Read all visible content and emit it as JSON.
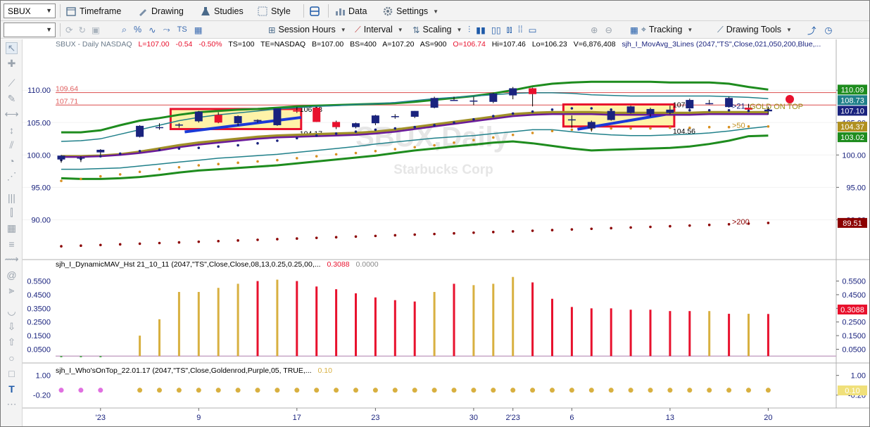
{
  "toolbar1": {
    "symbol": "SBUX",
    "timeframe": "Timeframe",
    "drawing": "Drawing",
    "studies": "Studies",
    "style": "Style",
    "data": "Data",
    "settings": "Settings"
  },
  "toolbar2": {
    "interval_box": "",
    "session_hours": "Session Hours",
    "interval": "Interval",
    "scaling": "Scaling",
    "tracking": "Tracking",
    "drawing_tools": "Drawing Tools"
  },
  "colors": {
    "up": "#1a237e",
    "down": "#e8112d",
    "ma21": "#6a1b9a",
    "ma50": "#8b8b22",
    "ma200": "#8b0000",
    "env_green": "#1e8c1e",
    "env_teal": "#20808a",
    "gold": "#d8b040",
    "redline": "#e06060"
  },
  "chart_data": [
    {
      "type": "candlestick",
      "title": "SBUX - Daily  NASDAQ",
      "header": {
        "last": "L=107.00",
        "chg": "-0.54",
        "pct": "-0.50%",
        "ts": "TS=100",
        "te": "TE=NASDAQ",
        "bid": "B=107.00",
        "bs": "BS=400",
        "ask": "A=107.20",
        "as": "AS=900",
        "open": "O=106.74",
        "hi": "Hi=107.46",
        "lo": "Lo=106.23",
        "vol": "V=6,876,408",
        "study": "sjh_I_MovAvg_3Lines (2047,\"TS\",Close,021,050,200,Blue,..."
      },
      "watermark": "SBUX,Daily",
      "watermark_sub": "Starbucks Corp",
      "ylim": [
        84.5,
        116.0
      ],
      "yticks": [
        "110.00",
        "105.00",
        "100.00",
        "95.00",
        "90.00"
      ],
      "ytick_values": [
        110,
        105,
        100,
        95,
        90
      ],
      "xticks": [
        {
          "label": "'23",
          "i": 2
        },
        {
          "label": "9",
          "i": 7
        },
        {
          "label": "17",
          "i": 12
        },
        {
          "label": "23",
          "i": 16
        },
        {
          "label": "30",
          "i": 21
        },
        {
          "label": "2'23",
          "i": 23
        },
        {
          "label": "6",
          "i": 26
        },
        {
          "label": "13",
          "i": 31
        },
        {
          "label": "20",
          "i": 36
        }
      ],
      "candles": [
        {
          "o": 99.3,
          "h": 100.0,
          "l": 98.8,
          "c": 99.9
        },
        {
          "o": 99.6,
          "h": 99.8,
          "l": 98.9,
          "c": 99.6
        },
        {
          "o": 100.4,
          "h": 100.9,
          "l": 100.0,
          "c": 100.8
        },
        {
          "o": 0,
          "h": 0,
          "l": 0,
          "c": 0
        },
        {
          "o": 102.8,
          "h": 104.6,
          "l": 102.7,
          "c": 104.5
        },
        {
          "o": 104.3,
          "h": 104.9,
          "l": 103.9,
          "c": 104.3
        },
        {
          "o": 104.7,
          "h": 104.9,
          "l": 104.2,
          "c": 104.7
        },
        {
          "o": 105.2,
          "h": 106.8,
          "l": 105.0,
          "c": 106.7
        },
        {
          "o": 106.2,
          "h": 106.6,
          "l": 104.9,
          "c": 105.0
        },
        {
          "o": 104.9,
          "h": 106.1,
          "l": 104.5,
          "c": 106.0
        },
        {
          "o": 105.2,
          "h": 105.5,
          "l": 105.0,
          "c": 105.4
        },
        {
          "o": 104.6,
          "h": 107.2,
          "l": 104.5,
          "c": 107.2
        },
        {
          "o": 106.9,
          "h": 107.4,
          "l": 106.5,
          "c": 106.7
        },
        {
          "o": 107.3,
          "h": 107.4,
          "l": 105.1,
          "c": 105.1
        },
        {
          "o": 105.1,
          "h": 105.3,
          "l": 104.0,
          "c": 104.3
        },
        {
          "o": 104.3,
          "h": 105.0,
          "l": 104.1,
          "c": 104.9
        },
        {
          "o": 104.9,
          "h": 106.2,
          "l": 104.6,
          "c": 106.1
        },
        {
          "o": 106.0,
          "h": 106.3,
          "l": 105.6,
          "c": 106.0
        },
        {
          "o": 105.9,
          "h": 106.8,
          "l": 105.7,
          "c": 106.8
        },
        {
          "o": 107.3,
          "h": 109.0,
          "l": 107.2,
          "c": 108.8
        },
        {
          "o": 108.5,
          "h": 109.0,
          "l": 108.4,
          "c": 108.5
        },
        {
          "o": 108.4,
          "h": 109.0,
          "l": 107.7,
          "c": 108.4
        },
        {
          "o": 108.2,
          "h": 109.6,
          "l": 108.0,
          "c": 109.5
        },
        {
          "o": 109.2,
          "h": 110.5,
          "l": 108.6,
          "c": 110.3
        },
        {
          "o": 110.3,
          "h": 110.4,
          "l": 107.5,
          "c": 109.4
        },
        {
          "o": 0,
          "h": 0,
          "l": 0,
          "c": 0
        },
        {
          "o": 105.5,
          "h": 106.1,
          "l": 104.2,
          "c": 105.5
        },
        {
          "o": 104.1,
          "h": 105.3,
          "l": 103.6,
          "c": 105.1
        },
        {
          "o": 105.4,
          "h": 106.9,
          "l": 105.3,
          "c": 106.8
        },
        {
          "o": 106.5,
          "h": 107.6,
          "l": 106.4,
          "c": 107.5
        },
        {
          "o": 106.3,
          "h": 107.3,
          "l": 105.9,
          "c": 107.1
        },
        {
          "o": 106.5,
          "h": 107.6,
          "l": 106.3,
          "c": 107.0
        },
        {
          "o": 107.2,
          "h": 108.7,
          "l": 107.1,
          "c": 108.5
        },
        {
          "o": 108.0,
          "h": 108.5,
          "l": 107.8,
          "c": 108.0
        },
        {
          "o": 107.4,
          "h": 109.0,
          "l": 107.3,
          "c": 108.8
        },
        {
          "o": 107.3,
          "h": 107.9,
          "l": 106.9,
          "c": 107.0
        },
        {
          "o": 106.74,
          "h": 107.46,
          "l": 106.23,
          "c": 107.0
        }
      ],
      "lines": {
        "env_green_upper": [
          103.5,
          103.5,
          103.8,
          104.6,
          105.3,
          105.7,
          106.2,
          106.6,
          106.8,
          107.0,
          107.1,
          107.3,
          107.5,
          107.6,
          107.7,
          107.8,
          107.9,
          108.0,
          108.2,
          108.5,
          108.8,
          109.1,
          109.5,
          110.0,
          110.6,
          111.0,
          111.2,
          111.3,
          111.3,
          111.3,
          111.3,
          111.2,
          111.2,
          111.2,
          111.0,
          110.5,
          110.1
        ],
        "env_teal_upper": [
          102.1,
          102.2,
          102.5,
          103.2,
          103.9,
          104.6,
          105.3,
          105.8,
          106.2,
          106.5,
          106.8,
          107.1,
          107.3,
          107.5,
          107.6,
          107.8,
          107.9,
          108.1,
          108.4,
          108.7,
          108.9,
          109.1,
          109.3,
          109.5,
          109.6,
          109.6,
          109.5,
          109.3,
          109.2,
          109.1,
          109.1,
          109.1,
          109.1,
          109.1,
          109.0,
          108.9,
          108.7
        ],
        "ma50_gold": [
          99.8,
          99.8,
          99.9,
          100.1,
          100.5,
          101.0,
          101.5,
          101.9,
          102.2,
          102.5,
          102.8,
          103.0,
          103.1,
          103.2,
          103.3,
          103.4,
          103.6,
          103.9,
          104.3,
          104.7,
          105.1,
          105.5,
          105.9,
          106.3,
          106.5,
          106.6,
          106.6,
          106.6,
          106.5,
          106.5,
          106.5,
          106.5,
          106.5,
          106.6,
          106.6,
          106.6,
          106.6
        ],
        "ma21_purple": [
          99.7,
          99.7,
          99.8,
          100.0,
          100.3,
          100.7,
          101.2,
          101.6,
          101.9,
          102.2,
          102.5,
          102.7,
          102.8,
          102.9,
          103.0,
          103.1,
          103.3,
          103.6,
          104.0,
          104.4,
          104.8,
          105.2,
          105.6,
          106.0,
          106.2,
          106.3,
          106.3,
          106.3,
          106.2,
          106.2,
          106.2,
          106.2,
          106.2,
          106.3,
          106.3,
          106.3,
          106.3
        ],
        "env_teal_lower": [
          97.8,
          97.8,
          97.9,
          98.0,
          98.3,
          98.6,
          98.9,
          99.2,
          99.5,
          99.7,
          99.9,
          100.1,
          100.4,
          100.7,
          101.0,
          101.3,
          101.7,
          102.0,
          102.3,
          102.6,
          102.8,
          103.0,
          103.3,
          103.6,
          103.9,
          103.9,
          103.6,
          103.3,
          103.1,
          103.0,
          103.0,
          103.1,
          103.2,
          103.4,
          103.7,
          104.1,
          104.4
        ],
        "env_green_lower": [
          96.4,
          96.3,
          96.3,
          96.4,
          96.6,
          96.9,
          97.3,
          97.6,
          97.8,
          98.0,
          98.2,
          98.4,
          98.7,
          99.0,
          99.3,
          99.6,
          99.9,
          100.3,
          100.7,
          101.0,
          101.3,
          101.6,
          101.9,
          102.1,
          101.8,
          101.4,
          101.0,
          100.7,
          100.8,
          100.9,
          101.0,
          101.1,
          101.3,
          101.7,
          102.2,
          102.9,
          103.0
        ]
      },
      "dots": {
        "blue": [
          99.2,
          99.4,
          99.8,
          100.2,
          100.6,
          100.8,
          101.0,
          101.1,
          101.3,
          101.5,
          101.8,
          102.2,
          102.6,
          103.0,
          103.3,
          103.6,
          103.9,
          104.1,
          104.3,
          104.6,
          105.0,
          105.5,
          106.0,
          106.4,
          106.7,
          107.0,
          107.2,
          107.2,
          107.0,
          106.9,
          106.8,
          106.8,
          106.9,
          106.9,
          106.9,
          106.8,
          107.0
        ],
        "gold": [
          96.0,
          96.3,
          96.7,
          97.0,
          97.4,
          97.8,
          98.1,
          98.4,
          98.6,
          98.8,
          99.0,
          99.2,
          99.5,
          99.8,
          100.1,
          100.3,
          100.6,
          100.9,
          101.2,
          101.5,
          101.9,
          102.3,
          102.7,
          103.1,
          103.4,
          103.7,
          103.9,
          104.0,
          104.1,
          104.1,
          104.1,
          104.2,
          104.2,
          104.3,
          104.3,
          104.4,
          104.4
        ],
        "dkred": [
          85.9,
          86.0,
          86.1,
          86.2,
          86.3,
          86.4,
          86.5,
          86.6,
          86.7,
          86.8,
          86.9,
          87.0,
          87.1,
          87.2,
          87.3,
          87.4,
          87.5,
          87.6,
          87.7,
          87.8,
          87.9,
          88.0,
          88.1,
          88.2,
          88.3,
          88.4,
          88.5,
          88.6,
          88.7,
          88.8,
          88.9,
          89.0,
          89.1,
          89.2,
          89.3,
          89.4,
          89.51
        ]
      },
      "hlines": [
        {
          "value": 109.64,
          "label": "109.64",
          "color": "#e06060"
        },
        {
          "value": 107.71,
          "label": "107.71",
          "color": "#e06060"
        }
      ],
      "boxes": [
        {
          "i0": 6,
          "i1": 12,
          "top": 107.1,
          "bottom": 104.0,
          "label_top": "106.68",
          "label_bottom": "104.17"
        },
        {
          "i0": 26,
          "i1": 31,
          "top": 107.8,
          "bottom": 104.4,
          "label_top": "107.",
          "label_bottom": "104.56"
        }
      ],
      "right_labels": [
        {
          "text": ">21",
          "value": 107.6,
          "color": "#1a237e"
        },
        {
          "text": ">50",
          "value": 104.6,
          "color": "#c09020"
        },
        {
          "text": ">200",
          "value": 89.7,
          "color": "#8b0000"
        }
      ],
      "gold_on_top": "GOLD ON TOP",
      "value_badges": [
        {
          "text": "110.09",
          "value": 110.09,
          "bg": "#1e8c1e",
          "fg": "#ffffff"
        },
        {
          "text": "108.73",
          "value": 108.73,
          "bg": "#20808a",
          "fg": "#ffffff"
        },
        {
          "text": "107.10",
          "value": 107.1,
          "bg": "#1a237e",
          "fg": "#ffffff"
        },
        {
          "text": "104.37",
          "value": 104.37,
          "bg": "#b09020",
          "fg": "#ffffff"
        },
        {
          "text": "103.02",
          "value": 103.02,
          "bg": "#1e8c1e",
          "fg": "#ffffff"
        },
        {
          "text": "89.51",
          "value": 89.51,
          "bg": "#8b0000",
          "fg": "#ffffff"
        }
      ]
    },
    {
      "type": "bar",
      "title": "sjh_I_DynamicMAV_Hst 21_10_11 (2047,\"TS\",Close,Close,08,13,0.25,0.25,00,...",
      "value1": "0.3088",
      "value2": "0.0000",
      "ylim": [
        -0.035,
        0.63
      ],
      "yticks": [
        "0.5500",
        "0.4500",
        "0.3500",
        "0.2500",
        "0.1500",
        "0.0500"
      ],
      "ytick_values": [
        0.55,
        0.45,
        0.35,
        0.25,
        0.15,
        0.05
      ],
      "badge": "0.3088",
      "values": [
        0.0,
        0.0,
        0.0,
        0.0,
        0.15,
        0.27,
        0.47,
        0.47,
        0.5,
        0.53,
        0.55,
        0.56,
        0.55,
        0.51,
        0.49,
        0.46,
        0.43,
        0.41,
        0.4,
        0.47,
        0.53,
        0.52,
        0.53,
        0.58,
        0.54,
        0.42,
        0.36,
        0.35,
        0.35,
        0.34,
        0.34,
        0.33,
        0.33,
        0.33,
        0.31,
        0.31,
        0.3088
      ],
      "colors": [
        "g",
        "g",
        "g",
        "",
        "y",
        "y",
        "y",
        "y",
        "y",
        "y",
        "r",
        "y",
        "r",
        "r",
        "r",
        "r",
        "r",
        "r",
        "r",
        "y",
        "r",
        "y",
        "y",
        "y",
        "r",
        "r",
        "r",
        "r",
        "r",
        "r",
        "r",
        "r",
        "r",
        "y",
        "r",
        "y",
        "r"
      ]
    },
    {
      "type": "scatter",
      "title": "sjh_I_Who'sOnTop_22.01.17 (2047,\"TS\",Close,Goldenrod,Purple,05, TRUE,...",
      "value": "0.10",
      "ylim": [
        -0.9,
        1.5
      ],
      "yticks": [
        "1.00",
        "-0.20"
      ],
      "ytick_values": [
        1.0,
        -0.2
      ],
      "badge": "0.10",
      "colors": [
        "p",
        "p",
        "p",
        "",
        "y",
        "y",
        "y",
        "y",
        "y",
        "y",
        "y",
        "y",
        "y",
        "y",
        "y",
        "y",
        "y",
        "y",
        "y",
        "y",
        "y",
        "y",
        "y",
        "y",
        "y",
        "y",
        "y",
        "y",
        "y",
        "y",
        "y",
        "y",
        "y",
        "y",
        "y",
        "y",
        "y"
      ]
    }
  ]
}
